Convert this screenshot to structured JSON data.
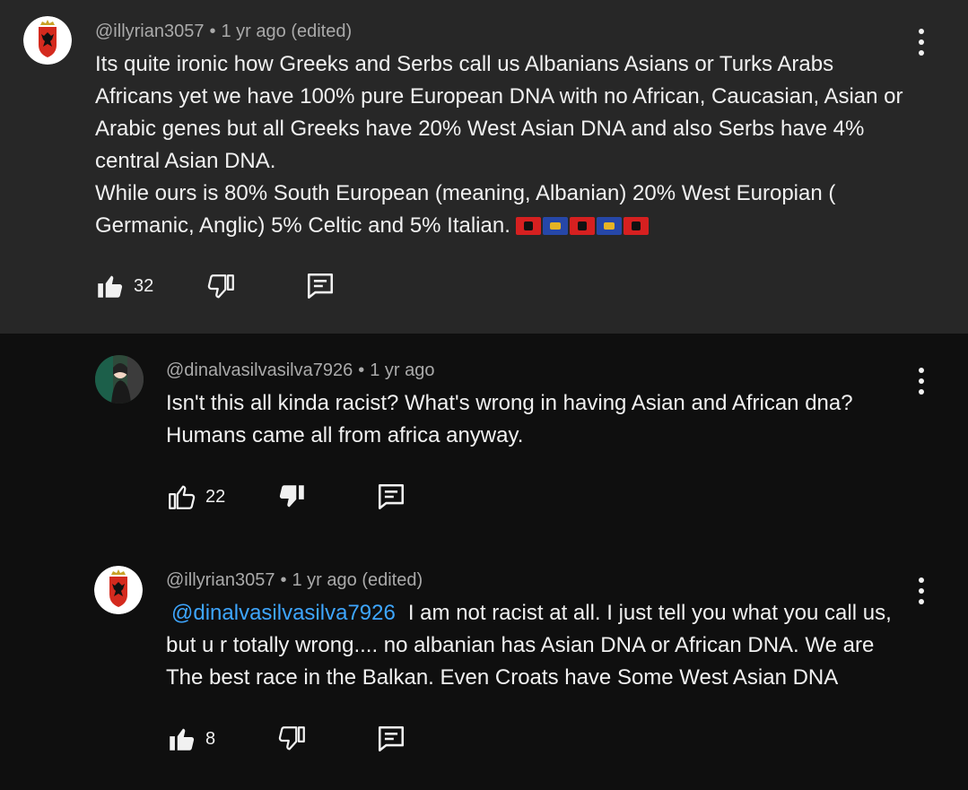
{
  "comments": [
    {
      "handle": "@illyrian3057",
      "time": "1 yr ago (edited)",
      "lines": [
        "Its quite ironic how Greeks and Serbs call us Albanians Asians or Turks Arabs Africans yet we have 100% pure European DNA with no African, Caucasian, Asian or Arabic genes but all Greeks have 20% West Asian DNA and also Serbs have 4% central Asian DNA.",
        "While ours is 80% South European (meaning, Albanian) 20% West Europian ( Germanic, Anglic) 5% Celtic and 5% Italian."
      ],
      "likes": "32",
      "liked": true,
      "disliked": false,
      "flags": [
        "albania",
        "kosovo",
        "albania",
        "kosovo",
        "albania"
      ]
    },
    {
      "handle": "@dinalvasilvasilva7926",
      "time": "1 yr ago",
      "text": "Isn't this all kinda racist? What's wrong in having Asian and African dna? Humans came all from africa anyway.",
      "likes": "22",
      "liked": false,
      "disliked": true
    },
    {
      "handle": "@illyrian3057",
      "time": "1 yr ago (edited)",
      "mention": "@dinalvasilvasilva7926",
      "text": "I am not racist at all. I just tell you what you call us, but u r totally wrong.... no albanian has Asian DNA or African DNA. We are The best race in the Balkan. Even Croats have Some West Asian DNA",
      "likes": "8",
      "liked": true,
      "disliked": false
    }
  ],
  "icons": {
    "like": "thumbs-up-icon",
    "dislike": "thumbs-down-icon",
    "reply": "reply-icon",
    "more": "more-vertical-icon"
  },
  "colors": {
    "highlight_bg": "#272727",
    "page_bg": "#0f0f0f",
    "mention": "#3ea6ff",
    "meta": "#aaaaaa"
  }
}
